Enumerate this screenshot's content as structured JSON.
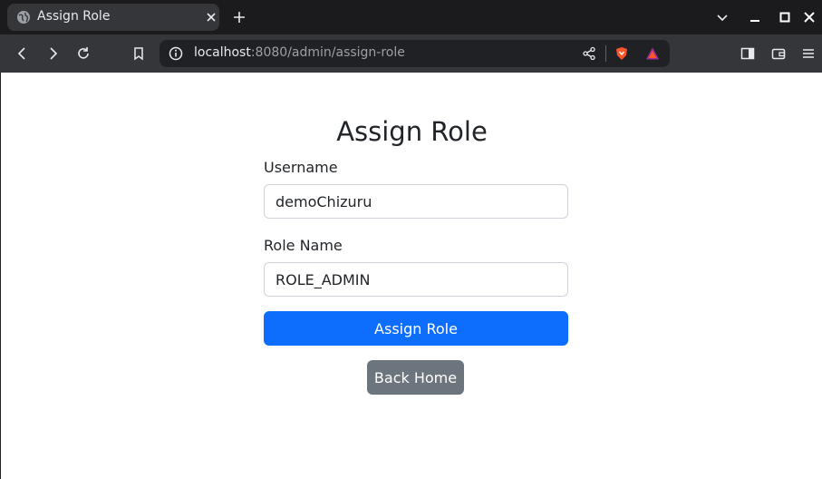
{
  "browser": {
    "tab": {
      "title": "Assign Role",
      "favicon": "globe-icon"
    },
    "url": {
      "host": "localhost",
      "path": ":8080/admin/assign-role"
    },
    "icons": [
      "back-icon",
      "forward-icon",
      "reload-icon",
      "bookmark-icon",
      "share-icon",
      "brave-shields-icon",
      "brave-rewards-icon",
      "sidebar-icon",
      "wallet-icon",
      "menu-icon"
    ]
  },
  "page": {
    "heading": "Assign Role",
    "username": {
      "label": "Username",
      "value": "demoChizuru"
    },
    "role": {
      "label": "Role Name",
      "value": "ROLE_ADMIN"
    },
    "submit_label": "Assign Role",
    "back_label": "Back Home"
  },
  "colors": {
    "primary": "#0d6efd",
    "secondary": "#6c757d",
    "brave_orange": "#fb542b"
  }
}
